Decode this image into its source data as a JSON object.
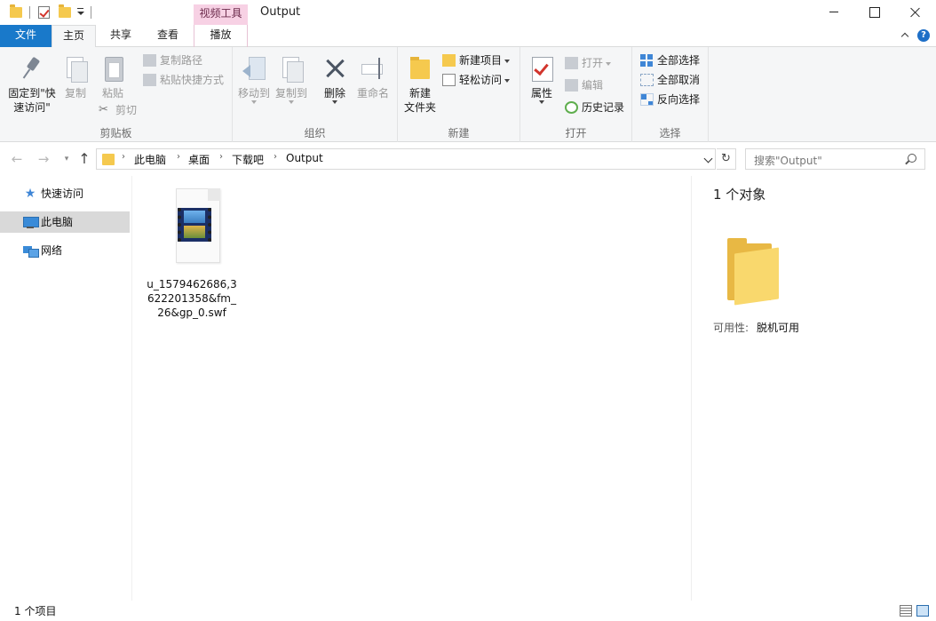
{
  "titlebar": {
    "context_tab_title": "视频工具",
    "window_title": "Output"
  },
  "tabs": {
    "file": "文件",
    "home": "主页",
    "share": "共享",
    "view": "查看",
    "play": "播放"
  },
  "ribbon": {
    "clipboard": {
      "pin_line1": "固定到\"快",
      "pin_line2": "速访问\"",
      "copy": "复制",
      "paste": "粘贴",
      "copy_path": "复制路径",
      "paste_shortcut": "粘贴快捷方式",
      "cut": "剪切",
      "label": "剪贴板"
    },
    "organize": {
      "move_to": "移动到",
      "copy_to": "复制到",
      "delete": "删除",
      "rename": "重命名",
      "label": "组织"
    },
    "new": {
      "new_folder_line1": "新建",
      "new_folder_line2": "文件夹",
      "new_item": "新建项目",
      "easy_access": "轻松访问",
      "label": "新建"
    },
    "open": {
      "properties": "属性",
      "open": "打开",
      "edit": "编辑",
      "history": "历史记录",
      "label": "打开"
    },
    "select": {
      "select_all": "全部选择",
      "select_none": "全部取消",
      "invert": "反向选择",
      "label": "选择"
    }
  },
  "address": {
    "crumbs": [
      "此电脑",
      "桌面",
      "下载吧",
      "Output"
    ],
    "search_placeholder": "搜索\"Output\""
  },
  "navpane": {
    "quick_access": "快速访问",
    "this_pc": "此电脑",
    "network": "网络"
  },
  "files": [
    {
      "name": "u_1579462686,3622201358&fm_26&gp_0.swf",
      "icon": "swf-video-file-icon"
    }
  ],
  "details": {
    "count": "1 个对象",
    "availability_label": "可用性:",
    "availability_value": "脱机可用"
  },
  "statusbar": {
    "count": "1 个项目"
  },
  "colors": {
    "file_tab": "#1979ca",
    "context_tab": "#f7d1e4",
    "selection": "#d9d9d9"
  }
}
